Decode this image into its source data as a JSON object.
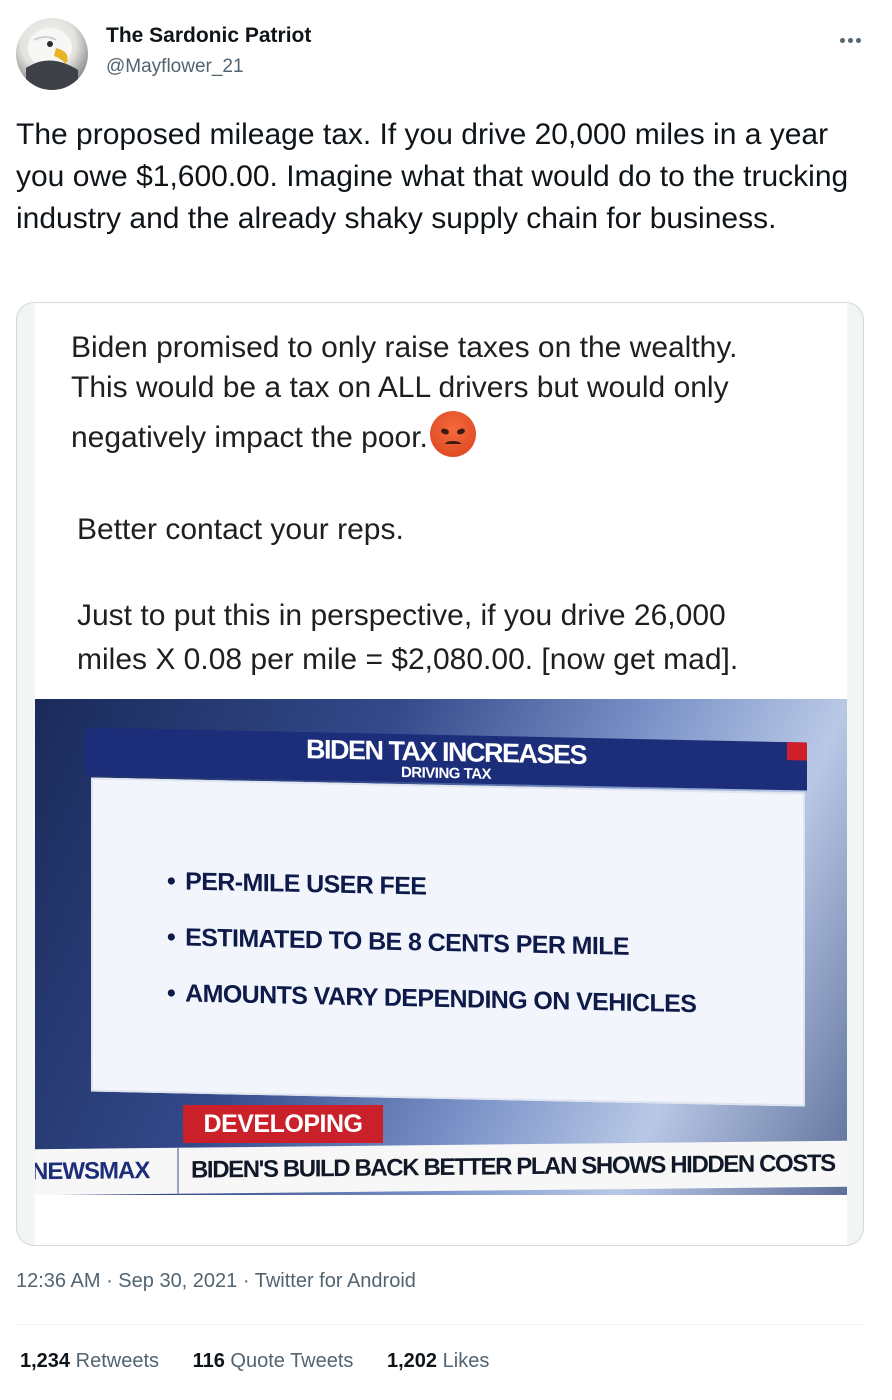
{
  "tweet": {
    "author": {
      "display_name": "The Sardonic Patriot",
      "handle": "@Mayflower_21",
      "avatar_icon": "bald-eagle-avatar"
    },
    "more_icon": "more-options-icon",
    "text": "The proposed mileage tax. If you drive 20,000 miles in a year you owe $1,600.00. Imagine what that would do to the trucking industry and the already shaky supply chain for business.",
    "timestamp": "12:36 AM",
    "date": "Sep 30, 2021",
    "source": "Twitter for Android",
    "stats": {
      "retweets_count": "1,234",
      "retweets_label": "Retweets",
      "quotes_count": "116",
      "quotes_label": "Quote Tweets",
      "likes_count": "1,202",
      "likes_label": "Likes"
    }
  },
  "media": {
    "post_lines": [
      "Biden promised to only raise taxes on the wealthy.",
      "This would be a tax on ALL drivers but would only",
      "negatively impact the poor."
    ],
    "emoji_icon": "angry-face-emoji",
    "reps_text": "Better contact your reps.",
    "perspective_lines": [
      "Just to put this in perspective, if you drive 26,000",
      "miles X 0.08 per mile = $2,080.00. [now get mad]."
    ],
    "tv": {
      "title": "BIDEN TAX INCREASES",
      "subtitle": "DRIVING TAX",
      "bullets": [
        "PER-MILE USER FEE",
        "ESTIMATED TO BE 8 CENTS PER MILE",
        "AMOUNTS VARY DEPENDING ON VEHICLES"
      ],
      "badge": "DEVELOPING",
      "brand": "NEWSMAX",
      "headline": "BIDEN'S BUILD BACK BETTER PLAN SHOWS HIDDEN COSTS",
      "colors": {
        "band": "#1c2d7a",
        "badge": "#c9202a"
      }
    }
  }
}
